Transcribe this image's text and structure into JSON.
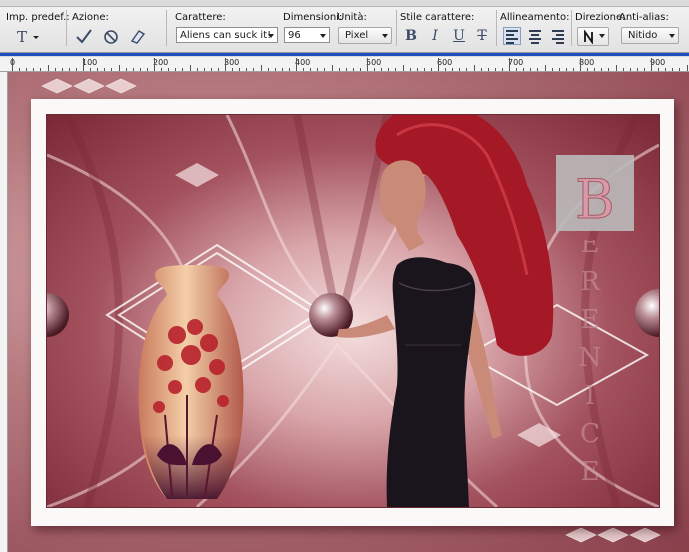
{
  "toolbar": {
    "preset_label": "Imp. predef.:",
    "action_label": "Azione:",
    "font_label": "Carattere:",
    "font_value": "Aliens can suck it!",
    "size_label": "Dimensioni:",
    "size_value": "96",
    "unit_label": "Unità:",
    "unit_value": "Pixel",
    "style_label": "Stile carattere:",
    "align_label": "Allineamento:",
    "direction_label": "Direzione:",
    "antialias_label": "Anti-alias:",
    "antialias_value": "Nitido",
    "style_buttons": [
      "B",
      "I",
      "U",
      "T"
    ]
  },
  "ruler": {
    "labels": [
      "0",
      "100",
      "200",
      "300",
      "400",
      "500",
      "600",
      "700",
      "800",
      "900"
    ]
  },
  "colors": {
    "accent": "#1f4fbf",
    "canvas_rose": "#b77b80",
    "dark_red": "#8a3f4b"
  },
  "watermark": {
    "letters": [
      "B",
      "E",
      "R",
      "E",
      "N",
      "I",
      "C",
      "E"
    ]
  }
}
